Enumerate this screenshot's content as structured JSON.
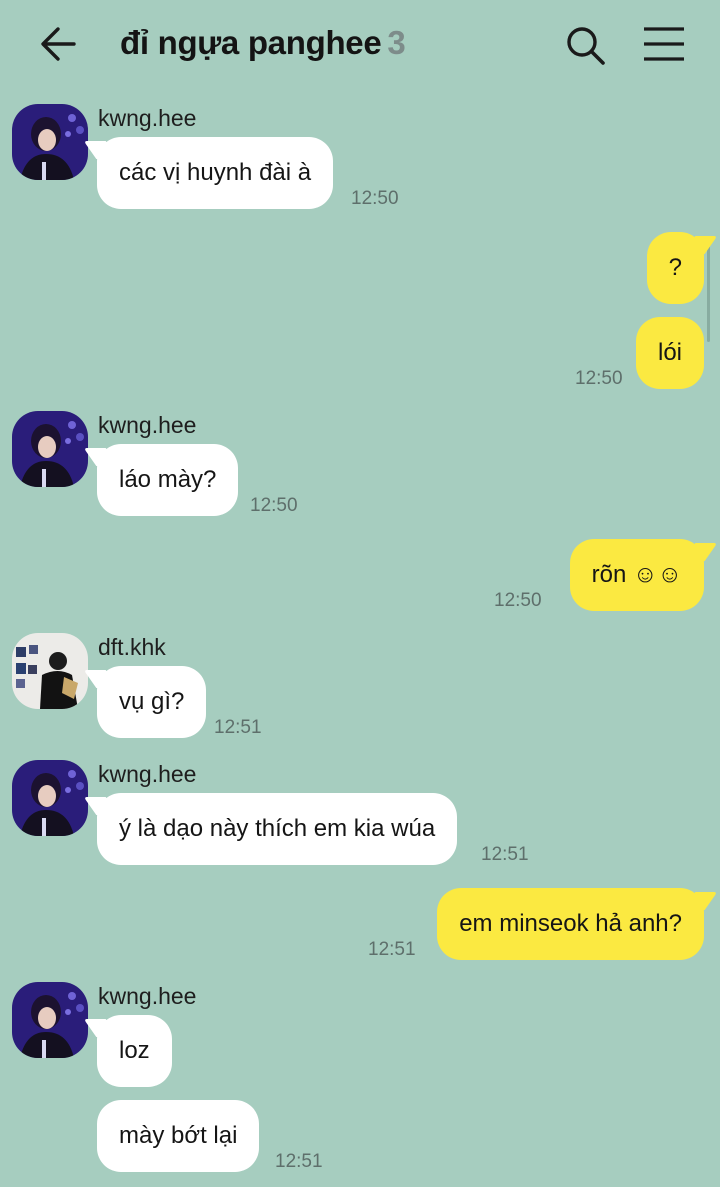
{
  "header": {
    "title": "đỉ ngựa panghee",
    "member_count": "3",
    "back_icon": "arrow-left-icon",
    "search_icon": "search-icon",
    "menu_icon": "hamburger-menu-icon"
  },
  "colors": {
    "background": "#a6cdbf",
    "incoming_bubble": "#ffffff",
    "outgoing_bubble": "#fbe941",
    "timestamp": "#5e6f6b"
  },
  "messages": [
    {
      "sender": "kwng.hee",
      "text": "các vị huynh đài à",
      "time": "12:50"
    },
    {
      "sender": "me",
      "text": "?"
    },
    {
      "sender": "me",
      "text": "lói",
      "time": "12:50"
    },
    {
      "sender": "kwng.hee",
      "text": "láo mày?",
      "time": "12:50"
    },
    {
      "sender": "me",
      "text": "rõn ☺☺",
      "time": "12:50"
    },
    {
      "sender": "dft.khk",
      "text": "vụ gì?",
      "time": "12:51"
    },
    {
      "sender": "kwng.hee",
      "text": "ý là dạo này thích em kia wúa",
      "time": "12:51"
    },
    {
      "sender": "me",
      "text": "em minseok hả anh?",
      "time": "12:51"
    },
    {
      "sender": "kwng.hee",
      "text": "loz"
    },
    {
      "sender": "kwng.hee",
      "text": "mày bớt lại",
      "time": "12:51"
    }
  ]
}
